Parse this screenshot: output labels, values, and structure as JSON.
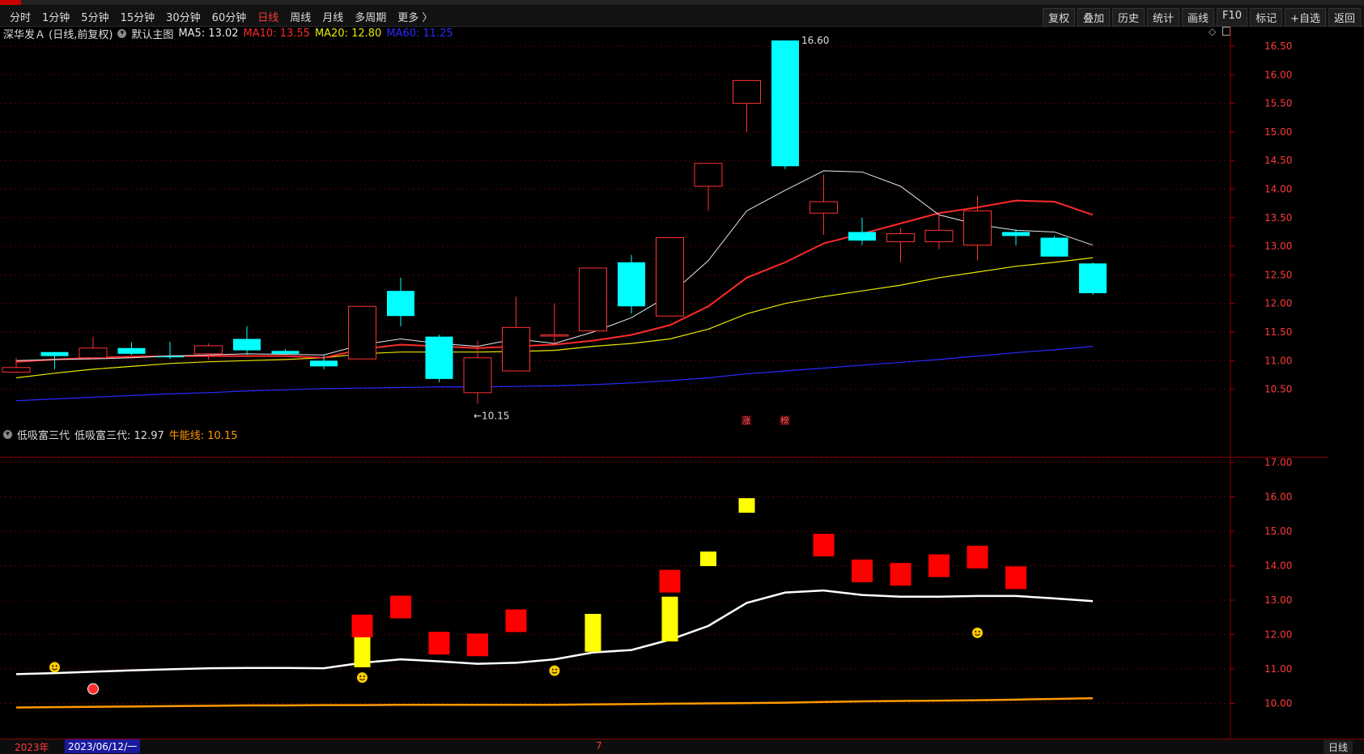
{
  "toolbar": {
    "periods": [
      "分时",
      "1分钟",
      "5分钟",
      "15分钟",
      "30分钟",
      "60分钟",
      "日线",
      "周线",
      "月线",
      "多周期",
      "更多 〉"
    ],
    "active_period": "日线",
    "tools": [
      "复权",
      "叠加",
      "历史",
      "统计",
      "画线",
      "F10",
      "标记",
      "+自选",
      "返回"
    ]
  },
  "main_panel": {
    "stock": "深华发Ａ (日线,前复权)",
    "indicator_name": "默认主图",
    "ma": [
      {
        "label": "MA5: 13.02",
        "color": "#e8e8e8"
      },
      {
        "label": "MA10: 13.55",
        "color": "#ff2a2a"
      },
      {
        "label": "MA20: 12.80",
        "color": "#e8e800"
      },
      {
        "label": "MA60: 11.25",
        "color": "#2a2aff"
      }
    ],
    "high_label": "16.60",
    "low_label": "←10.15",
    "markers": [
      "涨",
      "榜"
    ],
    "yticks": [
      "16.50",
      "16.00",
      "15.50",
      "15.00",
      "14.50",
      "14.00",
      "13.50",
      "13.00",
      "12.50",
      "12.00",
      "11.50",
      "11.00",
      "10.50"
    ]
  },
  "sub_panel": {
    "name": "低吸富三代",
    "value_label": "低吸富三代: 12.97",
    "line_label": "牛能线: 10.15",
    "yticks": [
      "17.00",
      "16.00",
      "15.00",
      "14.00",
      "13.00",
      "12.00",
      "11.00",
      "10.00"
    ]
  },
  "bottom": {
    "year": "2023年",
    "date": "2023/06/12/一",
    "month_mark": "7",
    "period": "日线"
  },
  "colors": {
    "up": "#ff3232",
    "down": "#00ffff",
    "ma5": "#e8e8e8",
    "ma10": "#ff2a2a",
    "ma20": "#e8e800",
    "ma60": "#2a2aff",
    "niu": "#ff9900"
  },
  "chart_data": {
    "type": "candlestick",
    "ylim": [
      10.15,
      16.6
    ],
    "candles": [
      {
        "o": 10.8,
        "h": 11.05,
        "l": 10.78,
        "c": 10.88
      },
      {
        "o": 11.15,
        "h": 11.15,
        "l": 10.85,
        "c": 11.08
      },
      {
        "o": 11.05,
        "h": 11.42,
        "l": 11.02,
        "c": 11.22
      },
      {
        "o": 11.22,
        "h": 11.32,
        "l": 11.1,
        "c": 11.12
      },
      {
        "o": 11.08,
        "h": 11.33,
        "l": 11.03,
        "c": 11.07
      },
      {
        "o": 11.12,
        "h": 11.3,
        "l": 11.02,
        "c": 11.26
      },
      {
        "o": 11.38,
        "h": 11.6,
        "l": 11.1,
        "c": 11.18
      },
      {
        "o": 11.17,
        "h": 11.2,
        "l": 11.1,
        "c": 11.12
      },
      {
        "o": 11.0,
        "h": 11.1,
        "l": 10.85,
        "c": 10.9
      },
      {
        "o": 11.03,
        "h": 11.95,
        "l": 11.03,
        "c": 11.95
      },
      {
        "o": 12.22,
        "h": 12.45,
        "l": 11.6,
        "c": 11.78
      },
      {
        "o": 11.42,
        "h": 11.45,
        "l": 10.62,
        "c": 10.68
      },
      {
        "o": 10.44,
        "h": 11.35,
        "l": 10.25,
        "c": 11.05
      },
      {
        "o": 10.82,
        "h": 12.12,
        "l": 10.82,
        "c": 11.58
      },
      {
        "o": 11.45,
        "h": 12.0,
        "l": 11.3,
        "c": 11.45
      },
      {
        "o": 11.52,
        "h": 12.62,
        "l": 11.52,
        "c": 12.62
      },
      {
        "o": 12.72,
        "h": 12.85,
        "l": 11.82,
        "c": 11.95
      },
      {
        "o": 11.78,
        "h": 13.15,
        "l": 11.78,
        "c": 13.15
      },
      {
        "o": 14.05,
        "h": 14.45,
        "l": 13.62,
        "c": 14.45
      },
      {
        "o": 15.5,
        "h": 15.9,
        "l": 15.0,
        "c": 15.9
      },
      {
        "o": 16.6,
        "h": 16.6,
        "l": 14.35,
        "c": 14.4
      },
      {
        "o": 13.58,
        "h": 14.25,
        "l": 13.2,
        "c": 13.78
      },
      {
        "o": 13.25,
        "h": 13.5,
        "l": 13.02,
        "c": 13.1
      },
      {
        "o": 13.08,
        "h": 13.32,
        "l": 12.72,
        "c": 13.22
      },
      {
        "o": 13.08,
        "h": 13.55,
        "l": 12.95,
        "c": 13.28
      },
      {
        "o": 13.02,
        "h": 13.88,
        "l": 12.75,
        "c": 13.62
      },
      {
        "o": 13.25,
        "h": 13.3,
        "l": 13.02,
        "c": 13.18
      },
      {
        "o": 13.15,
        "h": 13.18,
        "l": 12.82,
        "c": 12.82
      },
      {
        "o": 12.7,
        "h": 12.72,
        "l": 12.15,
        "c": 12.18
      }
    ],
    "ma5": [
      11.0,
      11.02,
      11.03,
      11.05,
      11.08,
      11.1,
      11.12,
      11.11,
      11.1,
      11.28,
      11.38,
      11.3,
      11.25,
      11.38,
      11.3,
      11.5,
      11.75,
      12.15,
      12.75,
      13.62,
      13.98,
      14.32,
      14.3,
      14.05,
      13.55,
      13.38,
      13.28,
      13.25,
      13.02
    ],
    "ma10": [
      10.98,
      11.02,
      11.05,
      11.07,
      11.08,
      11.08,
      11.08,
      11.08,
      11.05,
      11.2,
      11.28,
      11.25,
      11.22,
      11.25,
      11.28,
      11.35,
      11.45,
      11.62,
      11.95,
      12.45,
      12.72,
      13.05,
      13.22,
      13.4,
      13.58,
      13.68,
      13.8,
      13.78,
      13.55
    ],
    "ma20": [
      10.7,
      10.78,
      10.85,
      10.9,
      10.95,
      10.98,
      11.0,
      11.02,
      11.05,
      11.12,
      11.15,
      11.15,
      11.15,
      11.16,
      11.18,
      11.25,
      11.3,
      11.38,
      11.55,
      11.82,
      12.0,
      12.12,
      12.22,
      12.32,
      12.45,
      12.55,
      12.65,
      12.72,
      12.8
    ],
    "ma60": [
      10.3,
      10.33,
      10.36,
      10.39,
      10.42,
      10.44,
      10.47,
      10.49,
      10.51,
      10.52,
      10.53,
      10.54,
      10.54,
      10.55,
      10.56,
      10.58,
      10.61,
      10.65,
      10.7,
      10.77,
      10.82,
      10.87,
      10.92,
      10.97,
      11.02,
      11.08,
      11.14,
      11.19,
      11.25
    ]
  },
  "sub_chart_data": {
    "type": "indicator",
    "ylim": [
      10.0,
      17.0
    ],
    "white_line": [
      10.85,
      10.88,
      10.92,
      10.96,
      10.99,
      11.02,
      11.03,
      11.03,
      11.02,
      11.18,
      11.28,
      11.22,
      11.15,
      11.18,
      11.28,
      11.48,
      11.55,
      11.85,
      12.25,
      12.92,
      13.22,
      13.28,
      13.15,
      13.1,
      13.1,
      13.12,
      13.12,
      13.05,
      12.97
    ],
    "niu_line": [
      9.88,
      9.89,
      9.9,
      9.91,
      9.92,
      9.93,
      9.94,
      9.94,
      9.95,
      9.95,
      9.96,
      9.96,
      9.96,
      9.96,
      9.96,
      9.97,
      9.98,
      9.99,
      10.0,
      10.01,
      10.02,
      10.04,
      10.06,
      10.07,
      10.08,
      10.09,
      10.11,
      10.13,
      10.15
    ],
    "red_blocks": [
      {
        "i": 9,
        "v": 12.25
      },
      {
        "i": 10,
        "v": 12.8
      },
      {
        "i": 11,
        "v": 11.75
      },
      {
        "i": 12,
        "v": 11.7
      },
      {
        "i": 13,
        "v": 12.4
      },
      {
        "i": 17,
        "v": 13.55
      },
      {
        "i": 21,
        "v": 14.6
      },
      {
        "i": 22,
        "v": 13.85
      },
      {
        "i": 23,
        "v": 13.75
      },
      {
        "i": 24,
        "v": 14.0
      },
      {
        "i": 25,
        "v": 14.25
      },
      {
        "i": 26,
        "v": 13.65
      }
    ],
    "yellow_bars": [
      {
        "i": 9,
        "lo": 11.05,
        "hi": 11.95
      },
      {
        "i": 15,
        "lo": 11.5,
        "hi": 12.6
      },
      {
        "i": 17,
        "lo": 11.8,
        "hi": 13.1
      }
    ],
    "yellow_blocks": [
      {
        "i": 18,
        "v": 14.2
      },
      {
        "i": 19,
        "v": 15.75
      }
    ],
    "smileys": [
      {
        "i": 1,
        "v": 11.05
      },
      {
        "i": 9,
        "v": 10.75
      },
      {
        "i": 14,
        "v": 10.95
      },
      {
        "i": 25,
        "v": 12.05
      }
    ],
    "special_icon": {
      "i": 2,
      "v": 10.42
    }
  }
}
